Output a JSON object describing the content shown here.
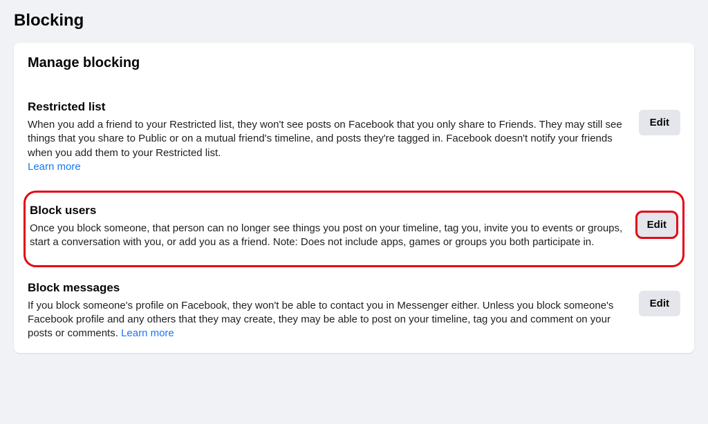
{
  "page": {
    "title": "Blocking"
  },
  "card": {
    "title": "Manage blocking"
  },
  "sections": {
    "restricted": {
      "title": "Restricted list",
      "desc": "When you add a friend to your Restricted list, they won't see posts on Facebook that you only share to Friends. They may still see things that you share to Public or on a mutual friend's timeline, and posts they're tagged in. Facebook doesn't notify your friends when you add them to your Restricted list.",
      "learn_more": "Learn more",
      "edit": "Edit"
    },
    "block_users": {
      "title": "Block users",
      "desc": "Once you block someone, that person can no longer see things you post on your timeline, tag you, invite you to events or groups, start a conversation with you, or add you as a friend. Note: Does not include apps, games or groups you both participate in.",
      "edit": "Edit"
    },
    "block_messages": {
      "title": "Block messages",
      "desc": "If you block someone's profile on Facebook, they won't be able to contact you in Messenger either. Unless you block someone's Facebook profile and any others that they may create, they may be able to post on your timeline, tag you and comment on your posts or comments.",
      "learn_more": "Learn more",
      "edit": "Edit"
    }
  }
}
